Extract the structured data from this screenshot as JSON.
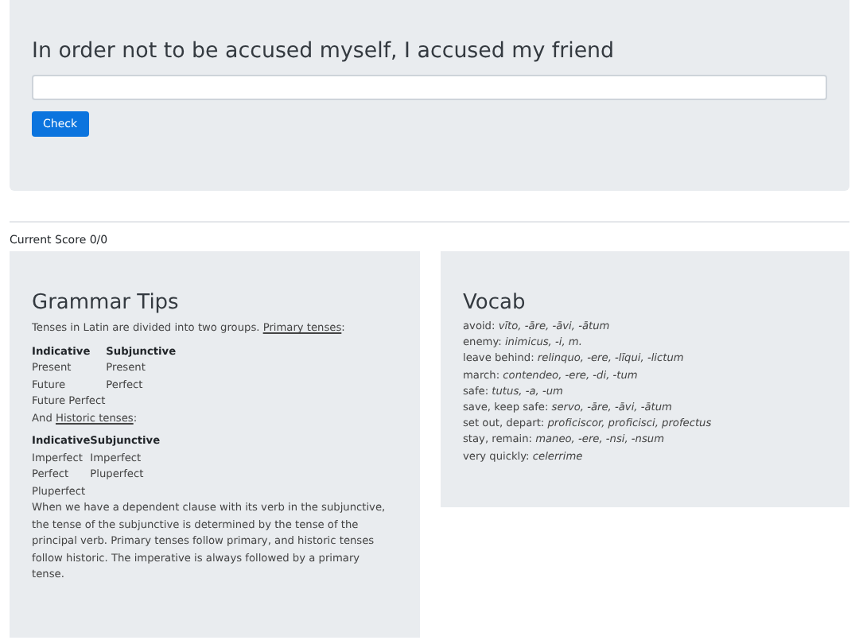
{
  "exercise": {
    "prompt": "In order not to be accused myself, I accused my friend",
    "check_button": "Check"
  },
  "score": "Current Score 0/0",
  "grammar_tips": {
    "title": "Grammar Tips",
    "sections": [
      {
        "before": "Tenses in Latin are divided into two groups. ",
        "link": "Primary tenses",
        "after": ":",
        "columns": [
          "Indicative",
          "Subjunctive"
        ],
        "rows": [
          [
            "Present",
            "Present"
          ],
          [
            "Future",
            "Perfect"
          ],
          [
            "Future Perfect",
            ""
          ]
        ]
      },
      {
        "before": "And ",
        "link": "Historic tenses",
        "after": ":",
        "columns": [
          "Indicative",
          "Subjunctive"
        ],
        "rows": [
          [
            "Imperfect",
            "Imperfect"
          ],
          [
            "Perfect",
            "Pluperfect"
          ],
          [
            "Pluperfect",
            ""
          ]
        ]
      }
    ],
    "note": "When we have a dependent clause with its verb in the subjunctive, the tense of the subjunctive is determined by the tense of the principal verb. Primary tenses follow primary, and historic tenses follow historic. The imperative is always followed by a primary tense."
  },
  "vocab": {
    "title": "Vocab",
    "entries": [
      {
        "english": "avoid:",
        "latin": "vīto, -āre, -āvi, -ātum"
      },
      {
        "english": "enemy:",
        "latin": "inimicus, -i, m."
      },
      {
        "english": "leave behind:",
        "latin": "relinquo, -ere, -līqui, -lictum"
      },
      {
        "english": "march:",
        "latin": "contendeo, -ere, -di, -tum"
      },
      {
        "english": "safe:",
        "latin": "tutus, -a, -um"
      },
      {
        "english": "save, keep safe:",
        "latin": "servo, -āre, -āvi, -ātum"
      },
      {
        "english": "set out, depart:",
        "latin": "proficiscor, proficisci, profectus"
      },
      {
        "english": "stay, remain:",
        "latin": "maneo, -ere, -nsi, -nsum"
      },
      {
        "english": "very quickly:",
        "latin": "celerrime"
      }
    ]
  }
}
